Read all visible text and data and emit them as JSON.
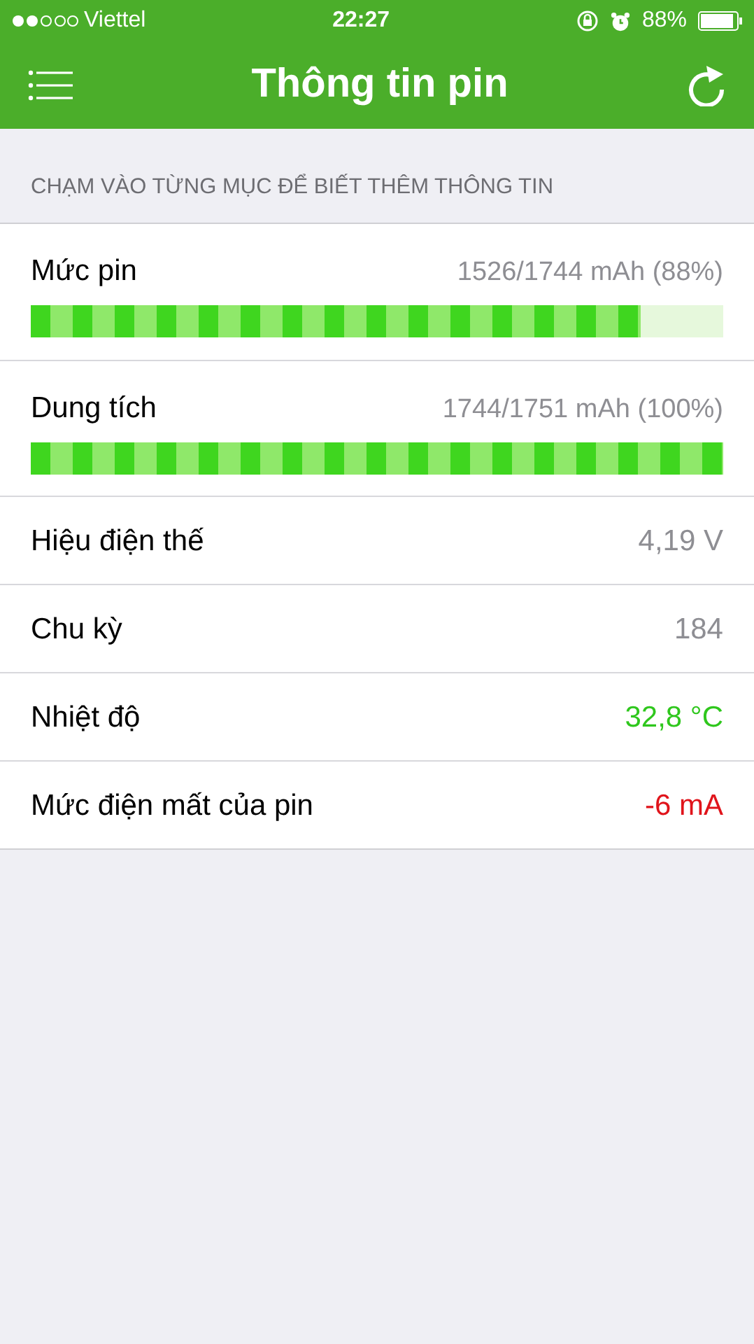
{
  "status_bar": {
    "carrier": "Viettel",
    "time": "22:27",
    "battery": "88%"
  },
  "navbar": {
    "title": "Thông tin pin"
  },
  "section_header": "CHẠM VÀO TỪNG MỤC ĐỂ BIẾT THÊM THÔNG TIN",
  "rows": [
    {
      "kind": "bar",
      "label": "Mức pin",
      "value": "1526/1744 mAh (88%)",
      "level": 0.88
    },
    {
      "kind": "bar",
      "label": "Dung tích",
      "value": "1744/1751 mAh (100%)",
      "level": 1.0
    },
    {
      "kind": "value",
      "label": "Hiệu điện thế",
      "value": "4,19 V",
      "color": "#8e8e93"
    },
    {
      "kind": "value",
      "label": "Chu kỳ",
      "value": "184",
      "color": "#8e8e93"
    },
    {
      "kind": "value",
      "label": "Nhiệt độ",
      "value": "32,8 °C",
      "color": "#2fc71d"
    },
    {
      "kind": "value",
      "label": "Mức điện mất của pin",
      "value": "-6 mA",
      "color": "#e0141b"
    }
  ]
}
